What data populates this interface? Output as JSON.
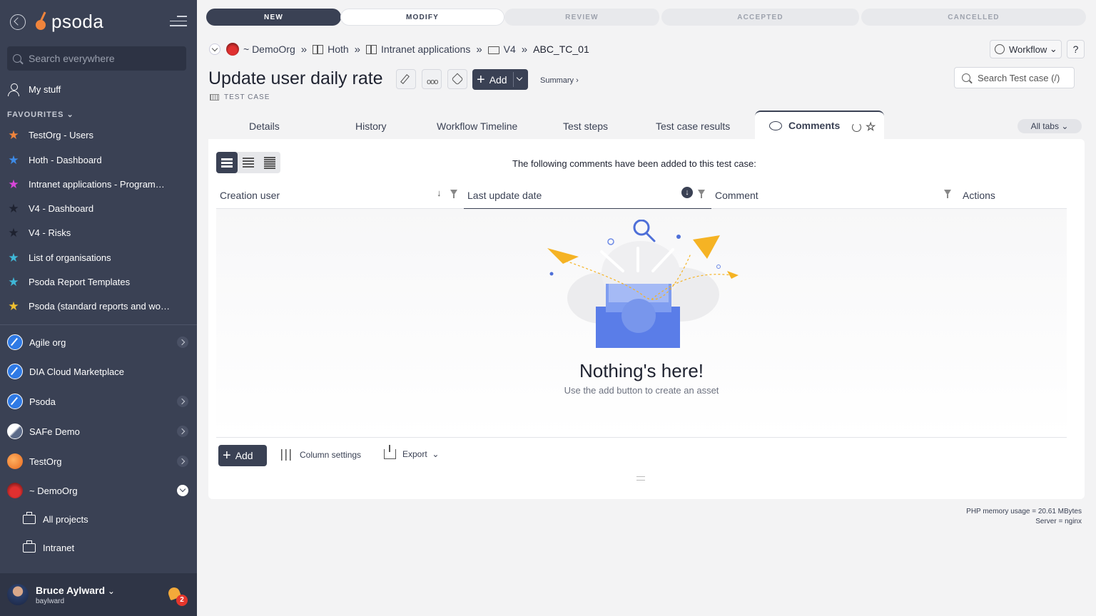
{
  "sidebar": {
    "search_placeholder": "Search everywhere",
    "my_stuff": "My stuff",
    "favourites_header": "FAVOURITES",
    "favourites": [
      {
        "label": "TestOrg - Users",
        "color": "#f0843c"
      },
      {
        "label": "Hoth - Dashboard",
        "color": "#3d8be8"
      },
      {
        "label": "Intranet applications - Programme...",
        "color": "#d946d9"
      },
      {
        "label": "V4 - Dashboard",
        "color": "#1e2230"
      },
      {
        "label": "V4 - Risks",
        "color": "#1e2230"
      },
      {
        "label": "List of organisations",
        "color": "#3fb8d8"
      },
      {
        "label": "Psoda Report Templates",
        "color": "#3fb8d8"
      },
      {
        "label": "Psoda (standard reports and work...",
        "color": "#f0c030"
      }
    ],
    "orgs": [
      {
        "label": "Agile org"
      },
      {
        "label": "DIA Cloud Marketplace"
      },
      {
        "label": "Psoda"
      },
      {
        "label": "SAFe Demo"
      },
      {
        "label": "TestOrg"
      },
      {
        "label": "~ DemoOrg"
      }
    ],
    "sub_items": [
      {
        "label": "All projects"
      },
      {
        "label": "Intranet"
      }
    ],
    "user": {
      "name": "Bruce Aylward",
      "handle": "baylward",
      "notifications": "2"
    }
  },
  "logo_text": "psoda",
  "workflow_stages": [
    {
      "label": "NEW",
      "state": "done"
    },
    {
      "label": "MODIFY",
      "state": "current"
    },
    {
      "label": "REVIEW",
      "state": "todo"
    },
    {
      "label": "ACCEPTED",
      "state": "todo"
    },
    {
      "label": "CANCELLED",
      "state": "todo"
    }
  ],
  "breadcrumb": {
    "org": "~ DemoOrg",
    "items": [
      "Hoth",
      "Intranet applications",
      "V4"
    ],
    "current": "ABC_TC_01"
  },
  "workflow_button": "Workflow",
  "help_button": "?",
  "page": {
    "title": "Update user daily rate",
    "type": "TEST CASE",
    "add_label": "Add",
    "summary_link": "Summary ›",
    "search_placeholder": "Search Test case (/)"
  },
  "tabs": [
    "Details",
    "History",
    "Workflow Timeline",
    "Test steps",
    "Test case results"
  ],
  "active_tab": "Comments",
  "all_tabs": "All tabs",
  "table": {
    "caption": "The following comments have been added to this test case:",
    "columns": [
      "Creation user",
      "Last update date",
      "Comment",
      "Actions"
    ],
    "empty_title": "Nothing's here!",
    "empty_subtitle": "Use the add button to create an asset",
    "add_label": "Add",
    "column_settings": "Column settings",
    "export": "Export"
  },
  "footer": {
    "memory": "PHP memory usage = 20.61 MBytes",
    "server": "Server = nginx"
  }
}
